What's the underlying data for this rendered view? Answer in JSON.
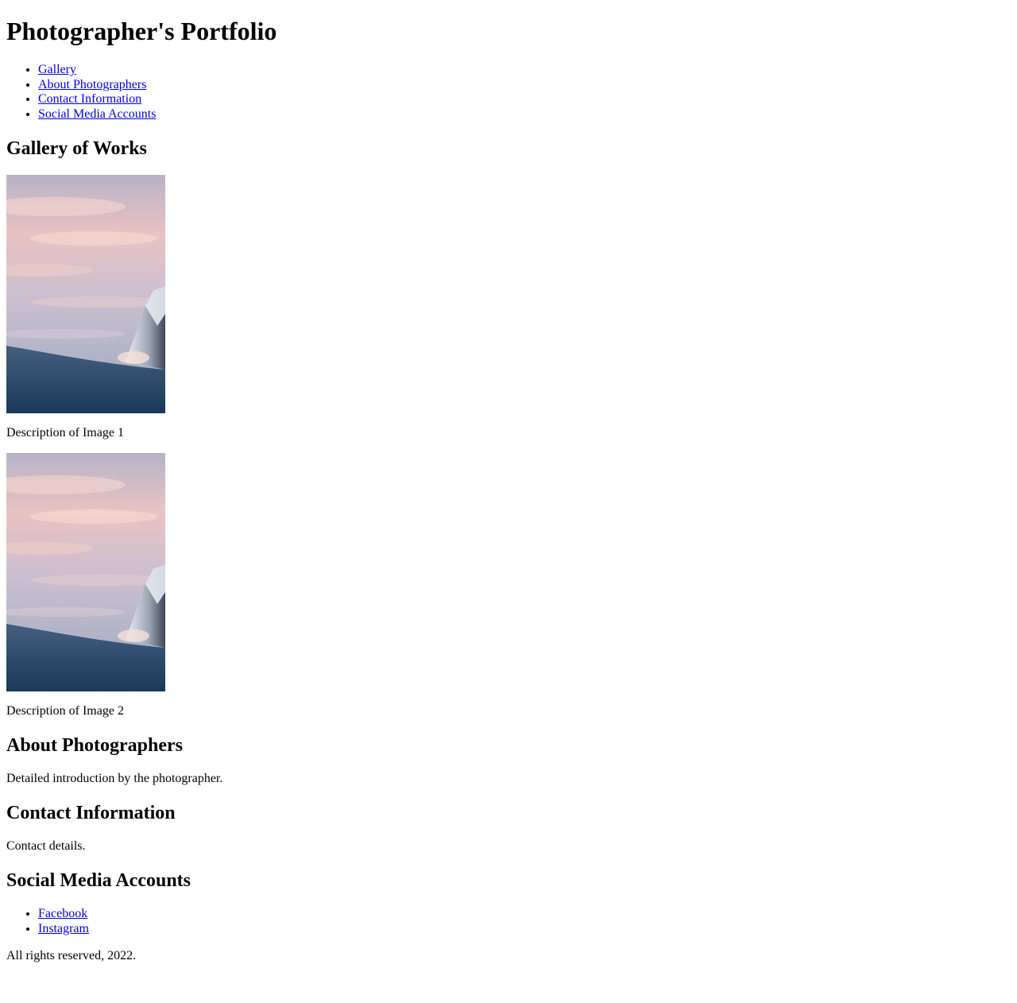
{
  "header": {
    "title": "Photographer's Portfolio"
  },
  "nav": {
    "items": [
      {
        "label": "Gallery"
      },
      {
        "label": "About Photographers"
      },
      {
        "label": "Contact Information"
      },
      {
        "label": "Social Media Accounts"
      }
    ]
  },
  "gallery": {
    "heading": "Gallery of Works",
    "items": [
      {
        "description": "Description of Image 1"
      },
      {
        "description": "Description of Image 2"
      }
    ]
  },
  "about": {
    "heading": "About Photographers",
    "text": "Detailed introduction by the photographer."
  },
  "contact": {
    "heading": "Contact Information",
    "text": "Contact details."
  },
  "social": {
    "heading": "Social Media Accounts",
    "links": [
      {
        "label": "Facebook"
      },
      {
        "label": "Instagram"
      }
    ]
  },
  "footer": {
    "text": "All rights reserved, 2022."
  },
  "colors": {
    "link": "#0000ee",
    "text": "#000000",
    "sky_top": "#c9b8c9",
    "sky_pink": "#f2c8c0",
    "snow_dark": "#1f3f63"
  }
}
